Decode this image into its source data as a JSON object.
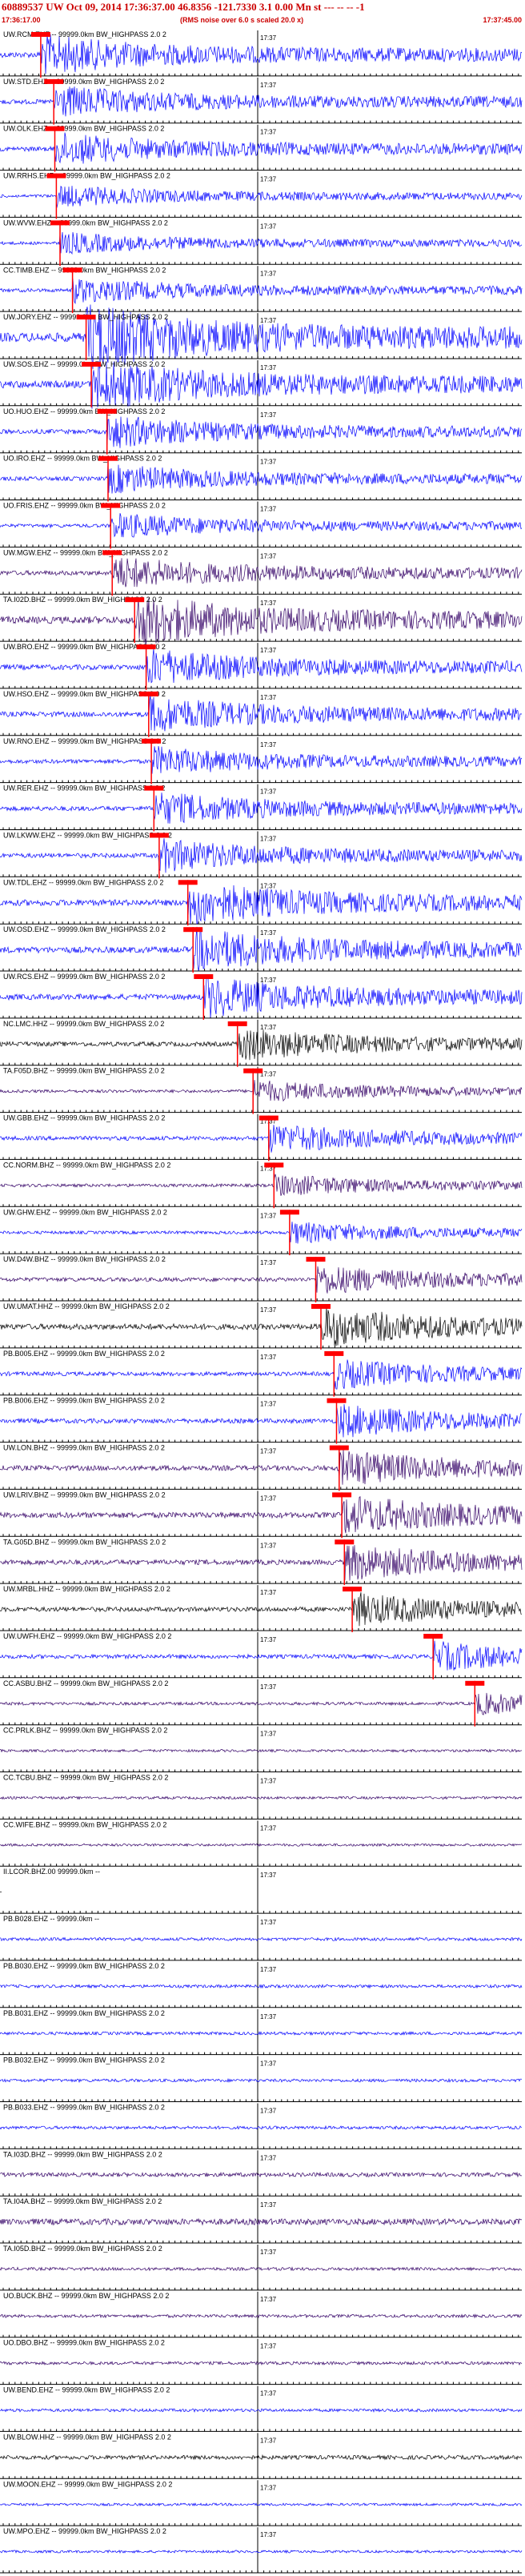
{
  "header": {
    "title": "60889537 UW Oct 09, 2014 17:36:37.00   46.8356 -121.7330  3.1 0.00 Mn st --- -- --  -1",
    "start_time": "17:36:17.00",
    "end_time": "17:37:45.00",
    "rms_note": "(RMS noise over 6.0 s scaled 20.0 x)"
  },
  "colors": {
    "blue": "#0000ff",
    "black": "#000000",
    "purple": "#330066",
    "pick": "#ff0000",
    "title": "#cc0000"
  },
  "chart_data": {
    "type": "line",
    "title": "60889537 UW Oct 09, 2014 17:36:37.00   46.8356 -121.7330  3.1 0.00 Mn st --- -- --  -1",
    "x_range": [
      "17:36:17.00",
      "17:37:45.00"
    ],
    "tick_label": "17:37",
    "series": [
      {
        "name": "UW.RCM.EHZ -- 99999.0km BW_HIGHPASS  2.0  2",
        "color": "blue",
        "amp": 0.55,
        "pick": 0.078
      },
      {
        "name": "UW.STD.EHZ -- 99999.0km BW_HIGHPASS  2.0  2",
        "color": "blue",
        "amp": 0.45,
        "pick": 0.103
      },
      {
        "name": "UW.OLK.EHZ -- 99999.0km BW_HIGHPASS  2.0  2",
        "color": "blue",
        "amp": 0.45,
        "pick": 0.105
      },
      {
        "name": "UW.RRHS.EHZ -- 99999.0km BW_HIGHPASS  2.0  2",
        "color": "blue",
        "amp": 0.3,
        "pick": 0.108
      },
      {
        "name": "UW.WVW.EHZ -- 99999.0km BW_HIGHPASS  2.0  2",
        "color": "blue",
        "amp": 0.3,
        "pick": 0.115
      },
      {
        "name": "CC.TIMB.EHZ -- 99999.0km BW_HIGHPASS  2.0  2",
        "color": "blue",
        "amp": 0.35,
        "pick": 0.139
      },
      {
        "name": "UW.JORY.EHZ -- 99999.0km BW_HIGHPASS  2.0  2",
        "color": "blue",
        "amp": 0.9,
        "pick": 0.165
      },
      {
        "name": "UW.SOS.EHZ -- 99999.0km BW_HIGHPASS  2.0  2",
        "color": "blue",
        "amp": 0.7,
        "pick": 0.175
      },
      {
        "name": "UO.HUO.EHZ -- 99999.0km BW_HIGHPASS  2.0  2",
        "color": "blue",
        "amp": 0.45,
        "pick": 0.205
      },
      {
        "name": "UO.IRO.EHZ -- 99999.0km BW_HIGHPASS  2.0  2",
        "color": "blue",
        "amp": 0.4,
        "pick": 0.207
      },
      {
        "name": "UO.FRIS.EHZ -- 99999.0km BW_HIGHPASS  2.0  2",
        "color": "blue",
        "amp": 0.35,
        "pick": 0.212
      },
      {
        "name": "UW.MGW.EHZ -- 99999.0km BW_HIGHPASS  2.0  2",
        "color": "purple",
        "amp": 0.45,
        "pick": 0.215
      },
      {
        "name": "TA.I02D.BHZ -- 99999.0km BW_HIGHPASS  2.0  2",
        "color": "purple",
        "amp": 0.7,
        "pick": 0.258
      },
      {
        "name": "UW.BRO.EHZ -- 99999.0km BW_HIGHPASS  2.0  2",
        "color": "blue",
        "amp": 0.5,
        "pick": 0.28
      },
      {
        "name": "UW.HSO.EHZ -- 99999.0km BW_HIGHPASS  2.0  2",
        "color": "blue",
        "amp": 0.5,
        "pick": 0.285
      },
      {
        "name": "UW.RNO.EHZ -- 99999.0km BW_HIGHPASS  2.0  2",
        "color": "blue",
        "amp": 0.4,
        "pick": 0.29
      },
      {
        "name": "UW.RER.EHZ -- 99999.0km BW_HIGHPASS  2.0  2",
        "color": "blue",
        "amp": 0.45,
        "pick": 0.295
      },
      {
        "name": "UW.LKWW.EHZ -- 99999.0km BW_HIGHPASS  2.0  2",
        "color": "blue",
        "amp": 0.45,
        "pick": 0.305
      },
      {
        "name": "UW.TDL.EHZ -- 99999.0km BW_HIGHPASS  2.0  2",
        "color": "blue",
        "amp": 0.6,
        "pick": 0.36
      },
      {
        "name": "UW.OSD.EHZ -- 99999.0km BW_HIGHPASS  2.0  2",
        "color": "blue",
        "amp": 0.6,
        "pick": 0.37
      },
      {
        "name": "UW.RCS.EHZ -- 99999.0km BW_HIGHPASS  2.0  2",
        "color": "blue",
        "amp": 0.55,
        "pick": 0.39
      },
      {
        "name": "NC.LMC.HHZ -- 99999.0km BW_HIGHPASS  2.0  2",
        "color": "black",
        "amp": 0.45,
        "pick": 0.455
      },
      {
        "name": "TA.F05D.BHZ -- 99999.0km BW_HIGHPASS  2.0  2",
        "color": "purple",
        "amp": 0.3,
        "pick": 0.485
      },
      {
        "name": "UW.GBB.EHZ -- 99999.0km BW_HIGHPASS  2.0  2",
        "color": "blue",
        "amp": 0.4,
        "pick": 0.515
      },
      {
        "name": "CC.NORM.BHZ -- 99999.0km BW_HIGHPASS  2.0  2",
        "color": "purple",
        "amp": 0.3,
        "pick": 0.525
      },
      {
        "name": "UW.GHW.EHZ -- 99999.0km BW_HIGHPASS  2.0  2",
        "color": "blue",
        "amp": 0.3,
        "pick": 0.555
      },
      {
        "name": "UW.D4W.BHZ -- 99999.0km BW_HIGHPASS  2.0  2",
        "color": "purple",
        "amp": 0.4,
        "pick": 0.605
      },
      {
        "name": "UW.UMAT.HHZ -- 99999.0km BW_HIGHPASS  2.0  2",
        "color": "black",
        "amp": 0.55,
        "pick": 0.615
      },
      {
        "name": "PB.B005.EHZ -- 99999.0km BW_HIGHPASS  2.0  2",
        "color": "blue",
        "amp": 0.4,
        "pick": 0.64
      },
      {
        "name": "PB.B006.EHZ -- 99999.0km BW_HIGHPASS  2.0  2",
        "color": "blue",
        "amp": 0.45,
        "pick": 0.645
      },
      {
        "name": "UW.LON.BHZ -- 99999.0km BW_HIGHPASS  2.0  2",
        "color": "purple",
        "amp": 0.5,
        "pick": 0.65
      },
      {
        "name": "UW.LRIV.BHZ -- 99999.0km BW_HIGHPASS  2.0  2",
        "color": "purple",
        "amp": 0.55,
        "pick": 0.655
      },
      {
        "name": "TA.G05D.BHZ -- 99999.0km BW_HIGHPASS  2.0  2",
        "color": "purple",
        "amp": 0.5,
        "pick": 0.66
      },
      {
        "name": "UW.MRBL.HHZ -- 99999.0km BW_HIGHPASS  2.0  2",
        "color": "black",
        "amp": 0.45,
        "pick": 0.675
      },
      {
        "name": "UW.UWFH.EHZ -- 99999.0km BW_HIGHPASS  2.0  2",
        "color": "blue",
        "amp": 0.4,
        "pick": 0.83
      },
      {
        "name": "CC.ASBU.BHZ -- 99999.0km BW_HIGHPASS  2.0  2",
        "color": "purple",
        "amp": 0.3,
        "pick": 0.91
      },
      {
        "name": "CC.PRLK.BHZ -- 99999.0km BW_HIGHPASS  2.0  2",
        "color": "purple",
        "amp": 0.25,
        "pick": null
      },
      {
        "name": "CC.TCBU.BHZ -- 99999.0km BW_HIGHPASS  2.0  2",
        "color": "purple",
        "amp": 0.25,
        "pick": null
      },
      {
        "name": "CC.WIFE.BHZ -- 99999.0km BW_HIGHPASS  2.0  2",
        "color": "purple",
        "amp": 0.25,
        "pick": null
      },
      {
        "name": "II.LCOR.BHZ.00 99999.0km --",
        "color": "black",
        "amp": 0.0,
        "pick": null
      },
      {
        "name": "PB.B028.EHZ -- 99999.0km --",
        "color": "blue",
        "amp": 0.3,
        "pick": null
      },
      {
        "name": "PB.B030.EHZ -- 99999.0km BW_HIGHPASS  2.0  2",
        "color": "blue",
        "amp": 0.3,
        "pick": null
      },
      {
        "name": "PB.B031.EHZ -- 99999.0km BW_HIGHPASS  2.0  2",
        "color": "blue",
        "amp": 0.3,
        "pick": null
      },
      {
        "name": "PB.B032.EHZ -- 99999.0km BW_HIGHPASS  2.0  2",
        "color": "blue",
        "amp": 0.3,
        "pick": null
      },
      {
        "name": "PB.B033.EHZ -- 99999.0km BW_HIGHPASS  2.0  2",
        "color": "blue",
        "amp": 0.3,
        "pick": null
      },
      {
        "name": "TA.I03D.BHZ -- 99999.0km BW_HIGHPASS  2.0  2",
        "color": "purple",
        "amp": 0.4,
        "pick": null
      },
      {
        "name": "TA.I04A.BHZ -- 99999.0km BW_HIGHPASS  2.0  2",
        "color": "purple",
        "amp": 0.6,
        "pick": null
      },
      {
        "name": "TA.I05D.BHZ -- 99999.0km BW_HIGHPASS  2.0  2",
        "color": "purple",
        "amp": 0.3,
        "pick": null
      },
      {
        "name": "UO.BUCK.BHZ -- 99999.0km BW_HIGHPASS  2.0  2",
        "color": "purple",
        "amp": 0.3,
        "pick": null
      },
      {
        "name": "UO.DBO.BHZ -- 99999.0km BW_HIGHPASS  2.0  2",
        "color": "purple",
        "amp": 0.3,
        "pick": null
      },
      {
        "name": "UW.BEND.EHZ -- 99999.0km BW_HIGHPASS  2.0  2",
        "color": "blue",
        "amp": 0.3,
        "pick": null
      },
      {
        "name": "UW.BLOW.HHZ -- 99999.0km BW_HIGHPASS  2.0  2",
        "color": "black",
        "amp": 0.4,
        "pick": null
      },
      {
        "name": "UW.MOON.EHZ -- 99999.0km BW_HIGHPASS  2.0  2",
        "color": "blue",
        "amp": 0.25,
        "pick": null
      },
      {
        "name": "UW.MPO.EHZ -- 99999.0km BW_HIGHPASS  2.0  2",
        "color": "blue",
        "amp": 0.25,
        "pick": null
      }
    ]
  }
}
